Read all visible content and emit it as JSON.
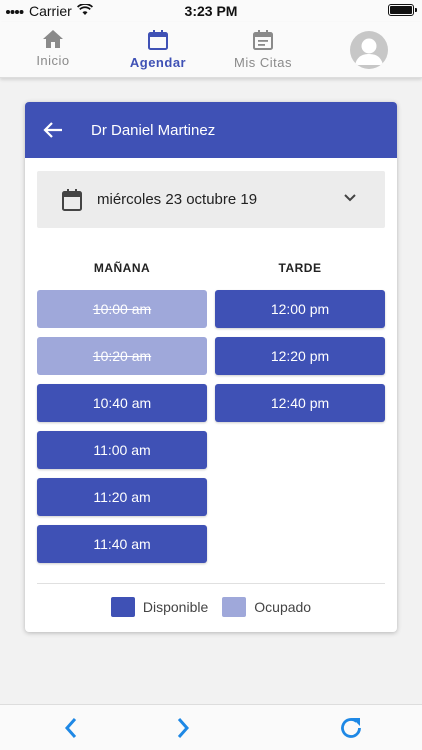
{
  "status_bar": {
    "carrier": "Carrier",
    "time": "3:23 PM",
    "battery_level": 1.0
  },
  "tabs": [
    {
      "label": "Inicio",
      "icon": "home-icon",
      "active": false
    },
    {
      "label": "Agendar",
      "icon": "calendar-icon",
      "active": true
    },
    {
      "label": "Mis Citas",
      "icon": "appointments-icon",
      "active": false
    }
  ],
  "profile": {
    "icon": "avatar-icon"
  },
  "card": {
    "title": "Dr Daniel Martinez",
    "date": "miércoles 23 octubre 19",
    "morning_label": "MAÑANA",
    "afternoon_label": "TARDE"
  },
  "slots": {
    "morning": [
      {
        "time": "10:00 am",
        "status": "busy"
      },
      {
        "time": "10:20 am",
        "status": "busy"
      },
      {
        "time": "10:40 am",
        "status": "available"
      },
      {
        "time": "11:00 am",
        "status": "available"
      },
      {
        "time": "11:20 am",
        "status": "available"
      },
      {
        "time": "11:40 am",
        "status": "available"
      }
    ],
    "afternoon": [
      {
        "time": "12:00 pm",
        "status": "available"
      },
      {
        "time": "12:20 pm",
        "status": "available"
      },
      {
        "time": "12:40 pm",
        "status": "available"
      }
    ]
  },
  "legend": {
    "available": "Disponible",
    "busy": "Ocupado"
  },
  "colors": {
    "primary": "#3f51b5",
    "busy": "#9fa8da",
    "accent": "#1e88e5"
  },
  "bottom_bar": {
    "icons": [
      "chevron-left-icon",
      "chevron-right-icon",
      "refresh-icon"
    ]
  }
}
